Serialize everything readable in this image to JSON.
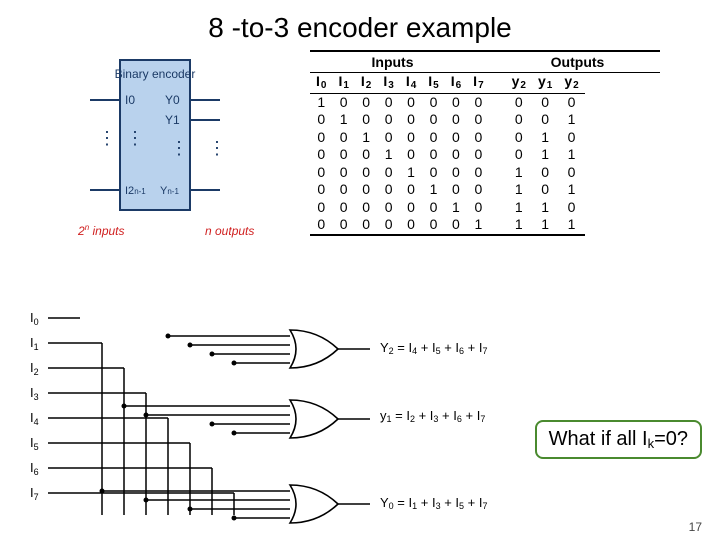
{
  "title": "8 -to-3 encoder example",
  "block": {
    "header": "Binary encoder",
    "left_top": "I0",
    "left_bot": "I2^n-1",
    "right_top": "Y0",
    "right_y1": "Y1",
    "right_bot": "Yn-1",
    "left_note": "2^n inputs",
    "right_note": "n outputs"
  },
  "table": {
    "group_inputs": "Inputs",
    "group_outputs": "Outputs",
    "in_heads": [
      "I 0",
      "I 1",
      "I 2",
      "I 3",
      "I 4",
      "I 5",
      "I 6",
      "I 7"
    ],
    "out_heads": [
      "y2",
      "y1",
      "y2"
    ],
    "rows": [
      {
        "in": [
          "1",
          "0",
          "0",
          "0",
          "0",
          "0",
          "0",
          "0"
        ],
        "out": [
          "0",
          "0",
          "0"
        ]
      },
      {
        "in": [
          "0",
          "1",
          "0",
          "0",
          "0",
          "0",
          "0",
          "0"
        ],
        "out": [
          "0",
          "0",
          "1"
        ]
      },
      {
        "in": [
          "0",
          "0",
          "1",
          "0",
          "0",
          "0",
          "0",
          "0"
        ],
        "out": [
          "0",
          "1",
          "0"
        ]
      },
      {
        "in": [
          "0",
          "0",
          "0",
          "1",
          "0",
          "0",
          "0",
          "0"
        ],
        "out": [
          "0",
          "1",
          "1"
        ]
      },
      {
        "in": [
          "0",
          "0",
          "0",
          "0",
          "1",
          "0",
          "0",
          "0"
        ],
        "out": [
          "1",
          "0",
          "0"
        ]
      },
      {
        "in": [
          "0",
          "0",
          "0",
          "0",
          "0",
          "1",
          "0",
          "0"
        ],
        "out": [
          "1",
          "0",
          "1"
        ]
      },
      {
        "in": [
          "0",
          "0",
          "0",
          "0",
          "0",
          "0",
          "1",
          "0"
        ],
        "out": [
          "1",
          "1",
          "0"
        ]
      },
      {
        "in": [
          "0",
          "0",
          "0",
          "0",
          "0",
          "0",
          "0",
          "1"
        ],
        "out": [
          "1",
          "1",
          "1"
        ]
      }
    ]
  },
  "schematic": {
    "inputs": [
      "I0",
      "I1",
      "I2",
      "I3",
      "I4",
      "I5",
      "I6",
      "I7"
    ]
  },
  "equations": {
    "y2": "Y2 = I4 + I5 + I6 + I7",
    "y1": "y1 = I2 + I3 + I6 + I7",
    "y0": "Y0 = I1 + I3 + I5 + I7"
  },
  "callout": "What if all Ik=0?",
  "page_number": "17"
}
